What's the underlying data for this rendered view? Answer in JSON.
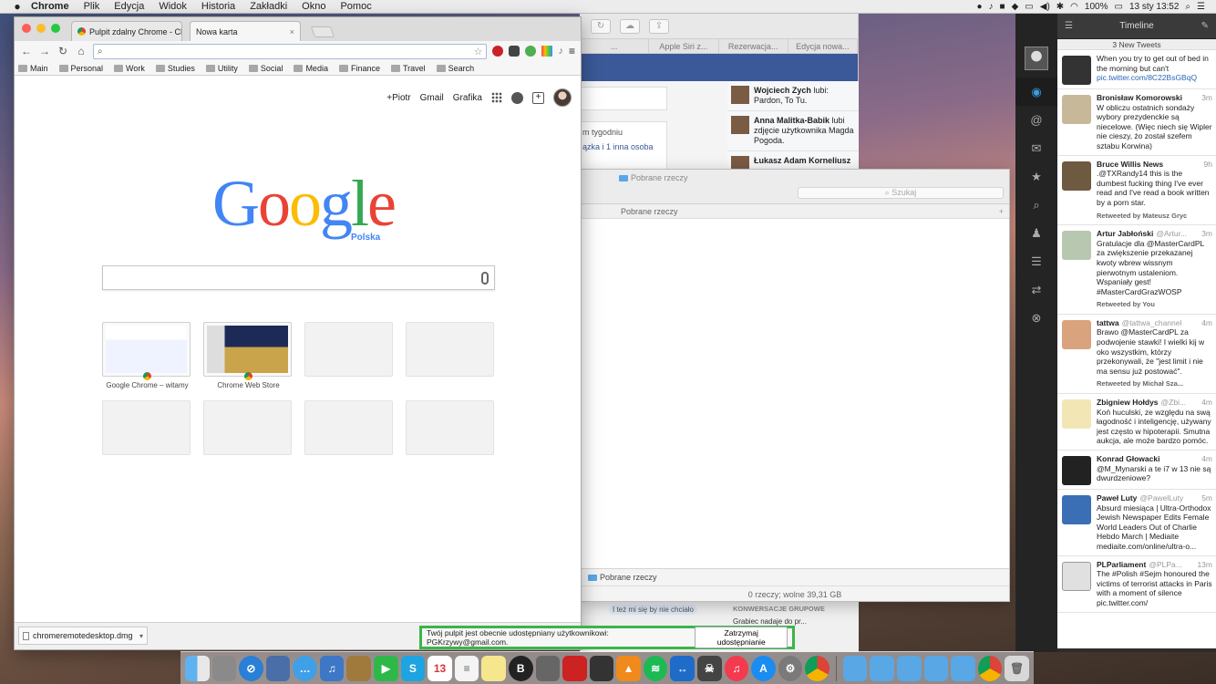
{
  "menubar": {
    "apple": "",
    "app": "Chrome",
    "items": [
      "Plik",
      "Edycja",
      "Widok",
      "Historia",
      "Zakładki",
      "Okno",
      "Pomoc"
    ],
    "battery": "100%",
    "datetime": "13 sty  13:52"
  },
  "chrome": {
    "tabs": [
      {
        "label": "Pulpit zdalny Chrome - Chr",
        "close": "×"
      },
      {
        "label": "Nowa karta",
        "close": "×"
      }
    ],
    "omnibox": {
      "value": "",
      "placeholder": ""
    },
    "bookmarks": [
      "Main",
      "Personal",
      "Work",
      "Studies",
      "Utility",
      "Social",
      "Media",
      "Finance",
      "Travel",
      "Search"
    ],
    "ntp": {
      "links": {
        "plus": "+Piotr",
        "gmail": "Gmail",
        "images": "Grafika"
      },
      "logo_sub": "Polska",
      "tiles": [
        {
          "caption": "Google Chrome – witamy"
        },
        {
          "caption": "Chrome Web Store"
        }
      ]
    },
    "download": {
      "filename": "chromeremotedesktop.dmg"
    }
  },
  "share_bar": {
    "text": "Twój pulpit jest obecnie udostępniany użytkownikowi: PGKrzywy@gmail.com.",
    "button": "Zatrzymaj udostępnianie"
  },
  "background_window": {
    "tabs": [
      "Apple Siri z...",
      "Rezerwacja...",
      "Edycja nowa..."
    ],
    "feed": [
      {
        "name": "Wojciech Zych",
        "text": " lubi: Pardon, To Tu."
      },
      {
        "name": "Anna Malitka-Babik",
        "text": " lubi zdjęcie użytkownika Magda Pogoda."
      },
      {
        "name": "Łukasz Adam Korneliusz",
        "text": ""
      }
    ],
    "snippet1": "m tygodniu",
    "snippet2": "ązka i 1 inna osoba",
    "chat_msg": "I też mi się by nie chciało",
    "group_title": "KONWERSACJE GRUPOWE",
    "group_item": "Grabiec nadaje do pr..."
  },
  "finder": {
    "title": "Pobrane rzeczy",
    "search_placeholder": "Szukaj",
    "path_label": "Pobrane rzeczy",
    "crumb": "Pobrane rzeczy",
    "status": "0 rzeczy; wolne 39,31 GB"
  },
  "tweetbot": {
    "header": "Timeline",
    "new_tweets": "3 New Tweets",
    "first_partial": {
      "text": "When you try to get out of bed in the morning but can't",
      "link": "pic.twitter.com/8C22BsGBqQ"
    },
    "tweets": [
      {
        "name": "Bronisław Komorowski",
        "user": "",
        "time": "3m",
        "text": "W obliczu ostatnich sondaży wybory prezydenckie są niecelowe. (Więc niech się Wipler nie cieszy, żo został szefem sztabu Korwina)",
        "rt": ""
      },
      {
        "name": "Bruce Willis News",
        "user": "",
        "time": "9h",
        "text": ".@TXRandy14 this is the dumbest fucking thing I've ever read and I've read a book written by a porn star.",
        "rt": "Retweeted by Mateusz Gryc"
      },
      {
        "name": "Artur Jabłoński",
        "user": "@Artur...",
        "time": "3m",
        "text": "Gratulacje dla @MasterCardPL za zwiększenie przekazanej kwoty wbrew wissnym pierwotnym ustaleniom. Wspaniały gest! #MasterCardGrazWOSP",
        "rt": "Retweeted by You"
      },
      {
        "name": "tattwa",
        "user": "@tattwa_channel",
        "time": "4m",
        "text": "Brawo @MasterCardPL za podwojenie stawki! I wielki kij w oko wszystkim, którzy przekonywali, że \"jest limit i nie ma sensu już postować\".",
        "rt": "Retweeted by Michał Sza..."
      },
      {
        "name": "Zbigniew Hołdys",
        "user": "@Zbi...",
        "time": "4m",
        "text": "Koń huculski, ze względu na swą łagodność i inteligencję, używany jest często w hipoterapii. Smutna aukcja, ale może bardzo pomóc.",
        "rt": ""
      },
      {
        "name": "Konrad Głowacki",
        "user": "",
        "time": "4m",
        "text": "@M_Mynarski a te i7 w 13 nie są dwurdzeniowe?",
        "rt": ""
      },
      {
        "name": "Paweł Luty",
        "user": "@PawelLuty",
        "time": "5m",
        "text": "Absurd miesiąca | Ultra-Orthodox Jewish Newspaper Edits Female World Leaders Out of Charlie Hebdo March | Mediaite mediaite.com/online/ultra-o...",
        "rt": ""
      },
      {
        "name": "PLParliament",
        "user": "@PLPa...",
        "time": "13m",
        "text": "The #Polish #Sejm honoured the victims of terrorist attacks in Paris with a moment of silence pic.twitter.com/",
        "rt": ""
      }
    ]
  },
  "colors": {
    "google_blue": "#4285f4",
    "google_red": "#ea4335",
    "google_yellow": "#fbbc05",
    "google_green": "#34a853",
    "share_border": "#3bb54a",
    "tweetbot_active": "#3d9bde"
  }
}
